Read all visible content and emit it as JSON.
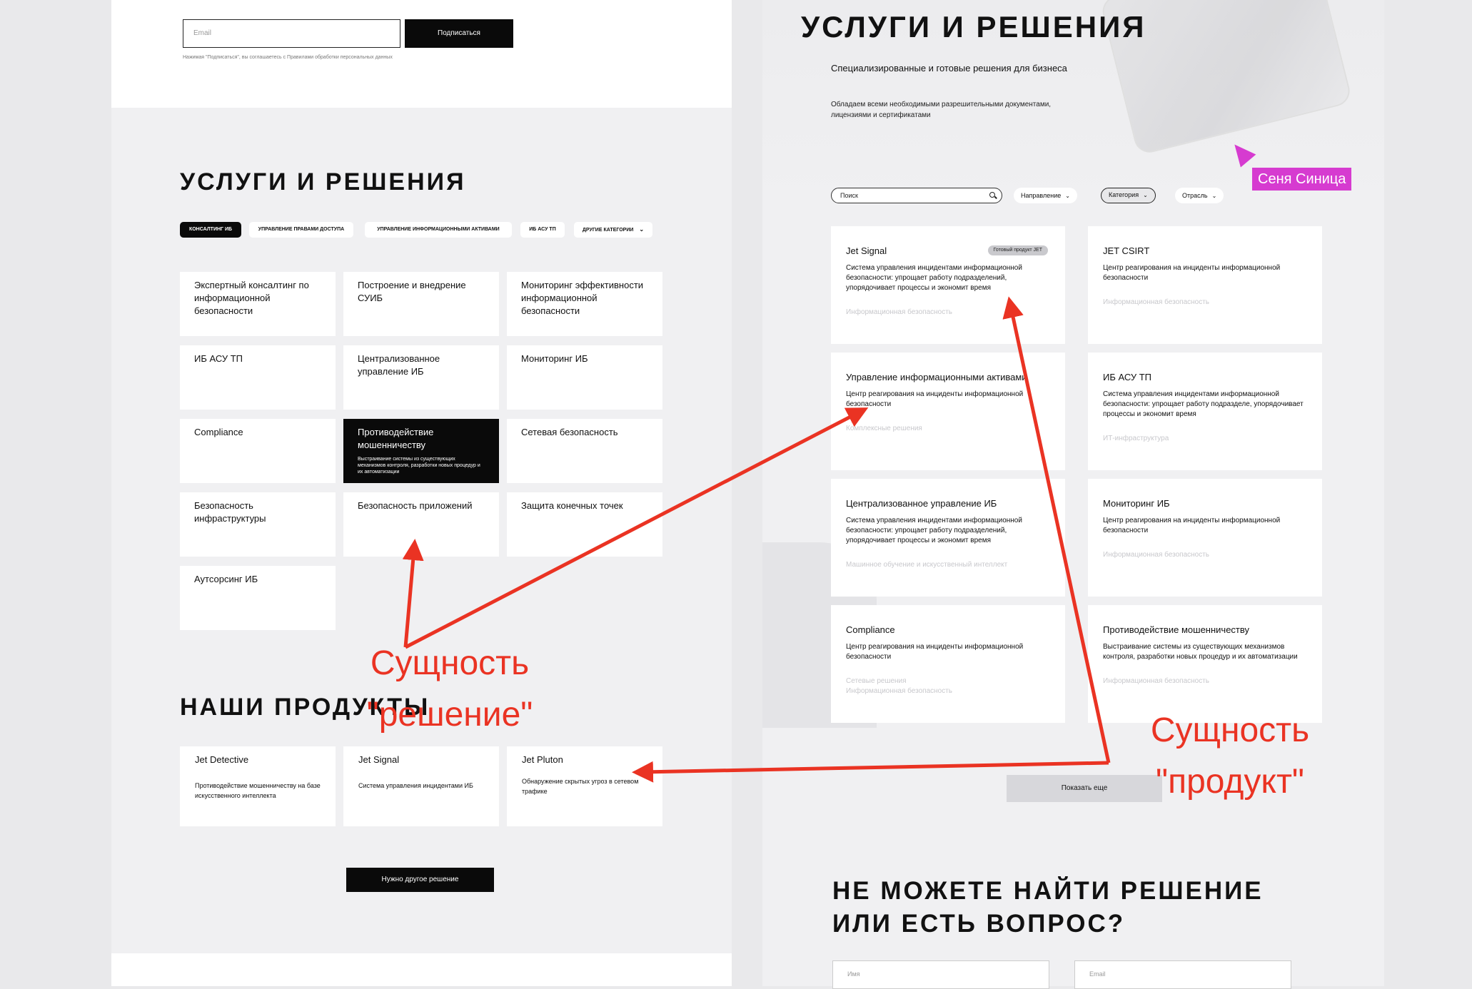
{
  "left": {
    "newsletter": {
      "email_placeholder": "Email",
      "subscribe_label": "Подписаться",
      "consent_text": "Нажимая \"Подписаться\", вы соглашаетесь с Правилами обработки персональных данных"
    },
    "services_title": "УСЛУГИ И РЕШЕНИЯ",
    "filter_chips": [
      "КОНСАЛТИНГ ИБ",
      "УПРАВЛЕНИЕ ПРАВАМИ ДОСТУПА",
      "УПРАВЛЕНИЕ ИНФОРМАЦИОННЫМИ АКТИВАМИ",
      "ИБ АСУ ТП",
      "ДРУГИЕ КАТЕГОРИИ"
    ],
    "service_cards": [
      "Экспертный консалтинг по информационной безопасности",
      "Построение и внедрение СУИБ",
      "Мониторинг эффективности информационной безопасности",
      "ИБ АСУ ТП",
      "Централизованное управление ИБ",
      "Мониторинг ИБ",
      "Compliance",
      "Противодействие мошенничеству",
      "Сетевая безопасность",
      "Безопасность инфраструктуры",
      "Безопасность приложений",
      "Защита конечных точек",
      "Аутсорсинг ИБ"
    ],
    "highlighted_card_desc": "Выстраивание системы из существующих механизмов контроля, разработки новых процедур и их автоматизации",
    "products_title": "НАШИ ПРОДУКТЫ",
    "products": [
      {
        "name": "Jet Detective",
        "desc": "Противодействие мошенничеству на базе искусственного интеллекта"
      },
      {
        "name": "Jet Signal",
        "desc": "Система управления инцидентами ИБ"
      },
      {
        "name": "Jet Pluton",
        "desc": "Обнаружение скрытых угроз в сетевом трафике"
      }
    ],
    "other_solution_label": "Нужно другое решение"
  },
  "right": {
    "title": "УСЛУГИ И РЕШЕНИЯ",
    "subtitle": "Специализированные и готовые решения для бизнеса",
    "subtitle2": "Обладаем всеми необходимыми разрешительными документами, лицензиями и сертификатами",
    "search_placeholder": "Поиск",
    "filters": [
      "Направление",
      "Категория",
      "Отрасль"
    ],
    "cursor_user": "Сеня Синица",
    "cards": [
      {
        "title": "Jet Signal",
        "badge": "Готовый продукт JET",
        "desc": "Система управления инцидентами информационной безопасности: упрощает работу подразделений, упорядочивает процессы и экономит время",
        "tags": [
          "Информационная безопасность"
        ]
      },
      {
        "title": "JET CSIRT",
        "desc": "Центр реагирования на инциденты информационной безопасности",
        "tags": [
          "Информационная безопасность"
        ]
      },
      {
        "title": "Управление информационными активами",
        "desc": "Центр реагирования на инциденты информационной безопасности",
        "tags": [
          "Комплексные решения"
        ]
      },
      {
        "title": "ИБ АСУ ТП",
        "desc": "Система управления инцидентами информационной безопасности: упрощает работу подразделе, упорядочивает процессы и экономит время",
        "tags": [
          "ИТ-инфраструктура"
        ]
      },
      {
        "title": "Централизованное управление ИБ",
        "desc": "Система управления инцидентами информационной безопасности: упрощает работу подразделений, упорядочивает процессы и экономит время",
        "tags": [
          "Машинное обучение и искусственный интеллект"
        ]
      },
      {
        "title": "Мониторинг ИБ",
        "desc": "Центр реагирования на инциденты информационной безопасности",
        "tags": [
          "Информационная безопасность"
        ]
      },
      {
        "title": "Compliance",
        "desc": "Центр реагирования на инциденты информационной безопасности",
        "tags": [
          "Сетевые решения",
          "Информационная безопасность"
        ]
      },
      {
        "title": "Противодействие мошенничеству",
        "desc": "Выстраивание системы из существующих механизмов контроля, разработки новых процедур и их автоматизации",
        "tags": [
          "Информационная безопасность"
        ]
      }
    ],
    "show_more_label": "Показать еще",
    "cant_find_title": "НЕ МОЖЕТЕ НАЙТИ РЕШЕНИЕ ИЛИ ЕСТЬ ВОПРОС?",
    "form": {
      "name_placeholder": "Имя",
      "email_placeholder": "Email"
    }
  },
  "annotations": {
    "solution": [
      "Сущность",
      "\"решение\""
    ],
    "product": [
      "Сущность",
      "\"продукт\""
    ]
  },
  "colors": {
    "annotation": "#ea3323",
    "cursor": "#d63bd0",
    "accent_dark": "#0a0a0a"
  }
}
